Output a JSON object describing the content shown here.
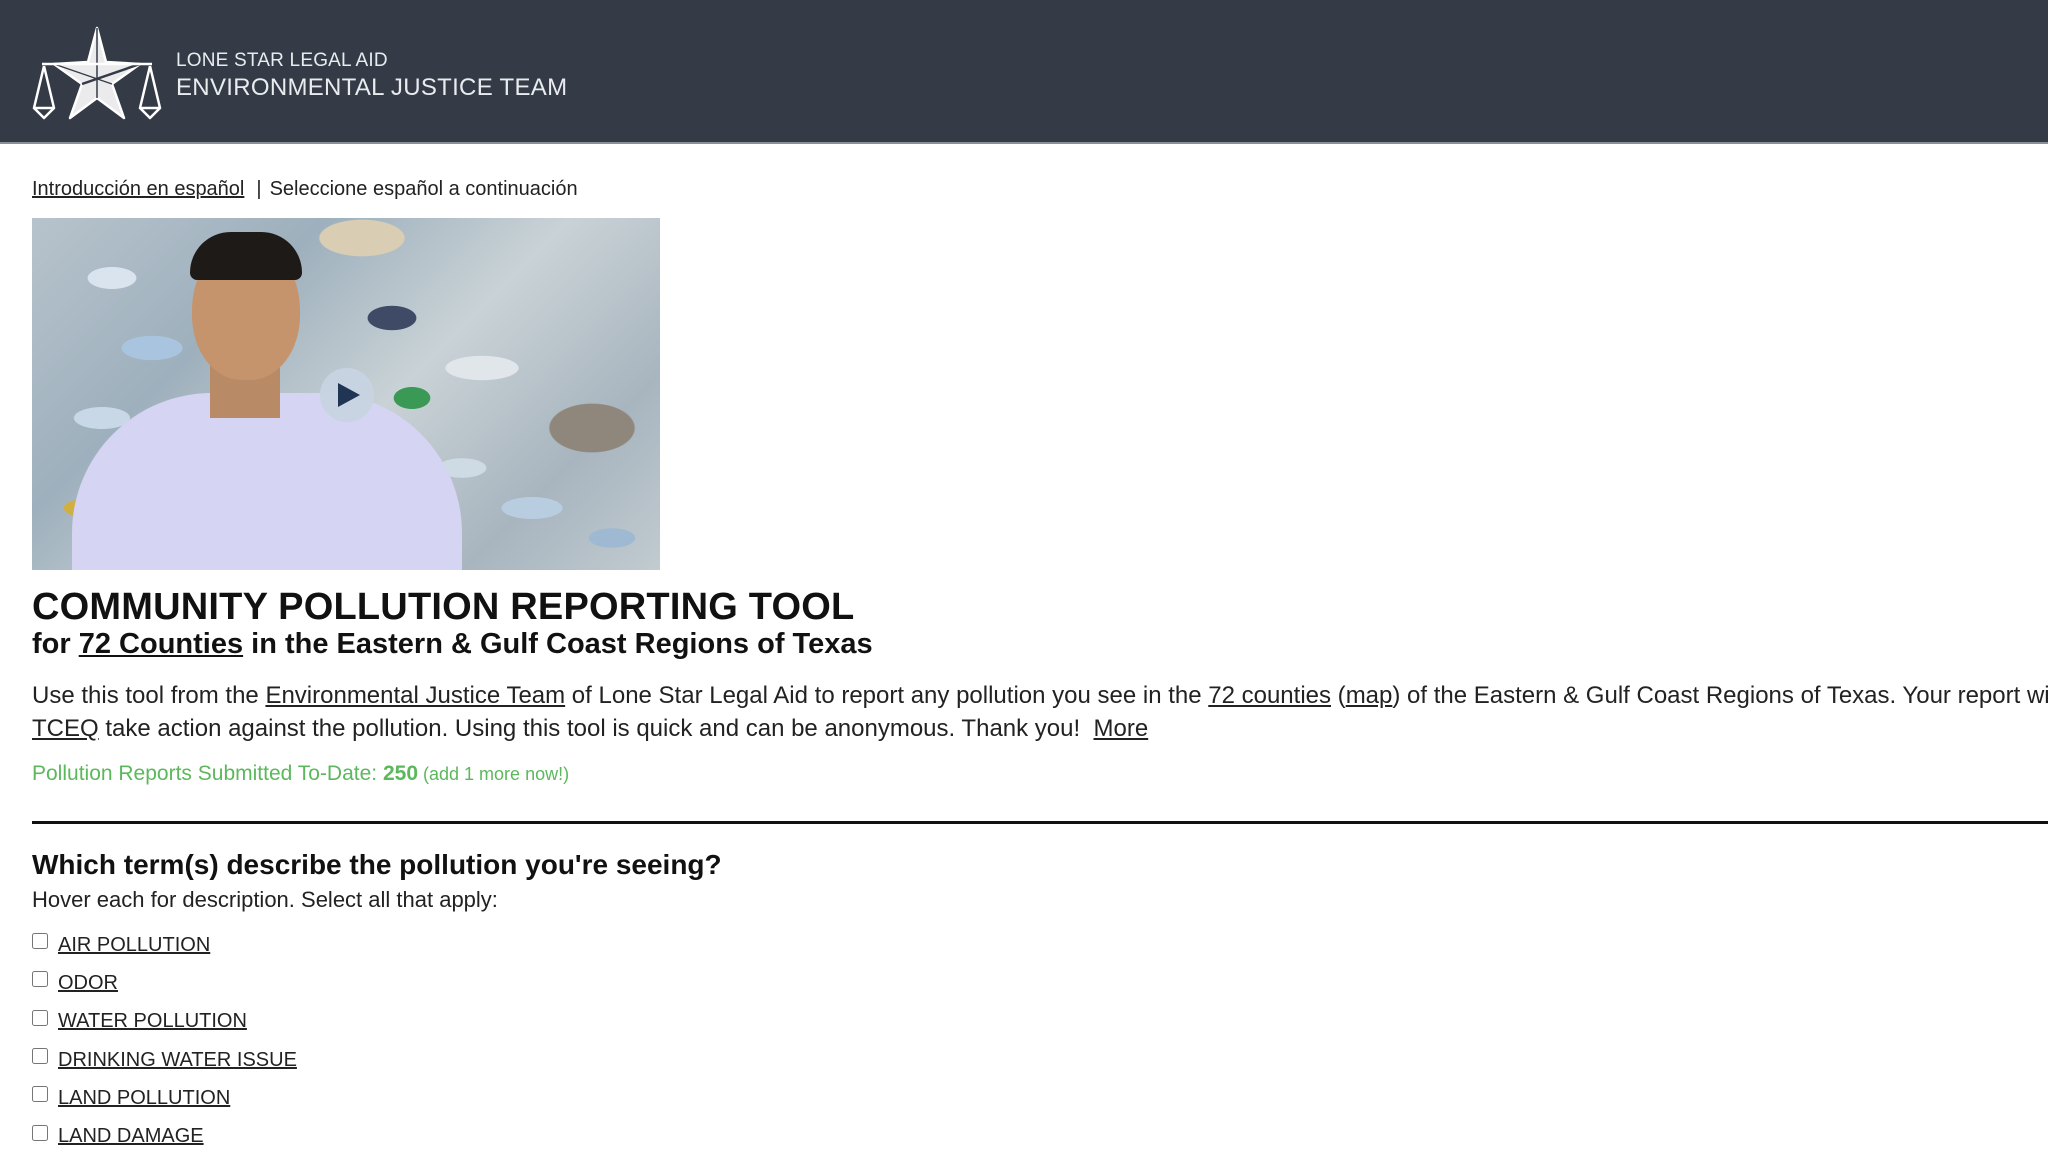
{
  "header": {
    "org_name": "LONE STAR LEGAL AID",
    "team_name": "ENVIRONMENTAL JUSTICE TEAM",
    "logo_icon": "star-scales-of-justice-icon",
    "background_color": "#343a46"
  },
  "language": {
    "spanish_link": "Introducción en español",
    "separator": "|",
    "spanish_hint": "Seleccione español a continuación"
  },
  "video": {
    "play_icon": "play-icon"
  },
  "main": {
    "title": "COMMUNITY POLLUTION REPORTING TOOL",
    "subtitle_prefix": "for ",
    "subtitle_link": "72 Counties",
    "subtitle_suffix": " in the Eastern & Gulf Coast Regions of Texas",
    "intro": {
      "t1": "Use this tool from the ",
      "link_team": "Environmental Justice Team",
      "t2": " of Lone Star Legal Aid to report any pollution you see in the ",
      "link_counties": "72 counties",
      "t3": " (",
      "link_map": "map",
      "t4": ") of the Eastern & Gulf Coast Regions of Texas. Your report wil",
      "link_tceq": "TCEQ",
      "t5": " take action against the pollution. Using this tool is quick and can be anonymous. Thank you!  ",
      "link_more": "More"
    },
    "counter": {
      "label": "Pollution Reports Submitted To-Date: ",
      "count": "250",
      "add_more": " (add 1 more now!)",
      "color": "#5cb85c"
    }
  },
  "form": {
    "question": "Which term(s) describe the pollution you're seeing?",
    "hint": "Hover each for description. Select all that apply:",
    "options": [
      {
        "label": "AIR POLLUTION",
        "checked": false
      },
      {
        "label": "ODOR",
        "checked": false
      },
      {
        "label": "WATER POLLUTION",
        "checked": false
      },
      {
        "label": "DRINKING WATER ISSUE",
        "checked": false
      },
      {
        "label": "LAND POLLUTION",
        "checked": false
      },
      {
        "label": "LAND DAMAGE",
        "checked": false
      }
    ]
  }
}
